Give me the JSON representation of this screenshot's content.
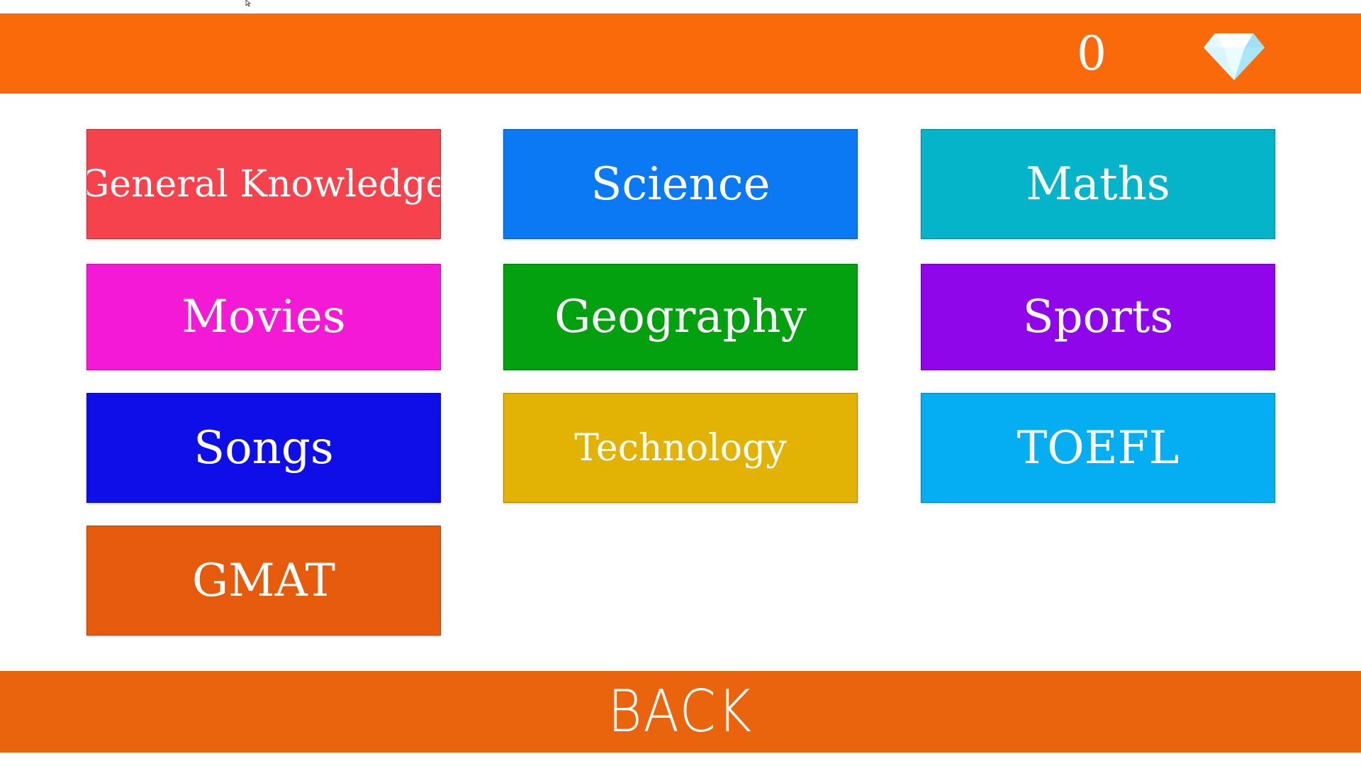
{
  "header": {
    "gem_count": "0",
    "gem_icon": "diamond-icon"
  },
  "categories": [
    {
      "label": "General Knowledge",
      "color": "#f5424c"
    },
    {
      "label": "Science",
      "color": "#0b78f4"
    },
    {
      "label": "Maths",
      "color": "#05b4c9"
    },
    {
      "label": "Movies",
      "color": "#f41ad5"
    },
    {
      "label": "Geography",
      "color": "#02a00e"
    },
    {
      "label": "Sports",
      "color": "#8f06ea"
    },
    {
      "label": "Songs",
      "color": "#0e0ee9"
    },
    {
      "label": "Technology",
      "color": "#e2b305"
    },
    {
      "label": "TOEFL",
      "color": "#05aef1"
    },
    {
      "label": "GMAT",
      "color": "#e65a0b"
    }
  ],
  "footer": {
    "back_label": "BACK"
  },
  "colors": {
    "top_bar": "#fa6a0a",
    "back_bar": "#ea640d"
  }
}
